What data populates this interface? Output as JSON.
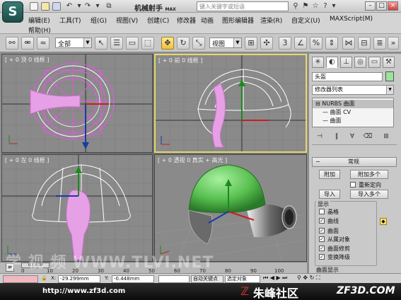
{
  "app": {
    "title": "机械射手",
    "title_suffix": "MAX",
    "search_placeholder": "键入关键字或短语",
    "logo_glyph": "S"
  },
  "menu": {
    "items": [
      "编辑",
      "工具",
      "组",
      "视图",
      "创建",
      "修改器",
      "动画",
      "图形编辑器",
      "渲染",
      "自定义",
      "MAXScript",
      "帮助"
    ],
    "item_suffixes": [
      "(E)",
      "(T)",
      "(G)",
      "(V)",
      "(C)",
      "",
      "",
      "",
      "(R)",
      "(U)",
      "(M)",
      "(H)"
    ]
  },
  "toolbar": {
    "selection_filter": "全部",
    "reference_coord": "视图"
  },
  "viewports": [
    {
      "label": "[ + 0 顶 0 线框 ]",
      "active": false
    },
    {
      "label": "[ + 0 前 0 线框 ]",
      "active": true
    },
    {
      "label": "[ + 0 左 0 线框 ]",
      "active": false
    },
    {
      "label": "[ + 0 透视 0 真实 + 高光 ]",
      "active": false
    }
  ],
  "command_panel": {
    "object_name": "头盔",
    "object_color": "#9be39a",
    "modifier_list": "修改器列表",
    "stack": [
      {
        "label": "NURBS 曲面",
        "selected": true
      },
      {
        "label": "曲面 CV",
        "selected": false
      },
      {
        "label": "曲面",
        "selected": false
      }
    ],
    "rollout_title": "常规",
    "buttons": {
      "attach": "附加",
      "attach_multiple": "附加多个",
      "reorient": "重新定向",
      "import": "导入",
      "import_multiple": "导入多个"
    },
    "display_group": "显示",
    "display_options": [
      {
        "label": "晶格",
        "checked": false
      },
      {
        "label": "曲线",
        "checked": true
      },
      {
        "label": "曲面",
        "checked": true
      },
      {
        "label": "从属对象",
        "checked": true
      },
      {
        "label": "曲面修剪",
        "checked": true
      },
      {
        "label": "变换降级",
        "checked": true
      }
    ],
    "next_group": "曲面显示"
  },
  "timeline": {
    "frame_display": "0 / 100",
    "ticks": [
      "0",
      "10",
      "20",
      "30",
      "40",
      "50",
      "60",
      "70",
      "80",
      "90",
      "100"
    ]
  },
  "status": {
    "x_value": "-29.299mm",
    "y_value": "-0.448mm",
    "auto_key": "自动关键点",
    "selected_object": "选定对象"
  },
  "watermarks": {
    "overlay": "学 视 频 WWW.TLVI.NET",
    "url": "http://www.zf3d.com",
    "site": "朱峰社区",
    "domain": "ZF3D.COM"
  }
}
